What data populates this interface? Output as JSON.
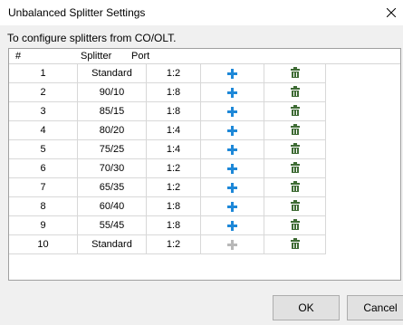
{
  "window": {
    "title": "Unbalanced Splitter Settings",
    "close_icon": "close-icon"
  },
  "instructions": "To configure splitters from CO/OLT.",
  "table": {
    "headers": [
      "#",
      "Splitter",
      "Port"
    ],
    "rows": [
      {
        "num": "1",
        "splitter": "Standard",
        "port": "1:2",
        "add_enabled": true
      },
      {
        "num": "2",
        "splitter": "90/10",
        "port": "1:8",
        "add_enabled": true
      },
      {
        "num": "3",
        "splitter": "85/15",
        "port": "1:8",
        "add_enabled": true
      },
      {
        "num": "4",
        "splitter": "80/20",
        "port": "1:4",
        "add_enabled": true
      },
      {
        "num": "5",
        "splitter": "75/25",
        "port": "1:4",
        "add_enabled": true
      },
      {
        "num": "6",
        "splitter": "70/30",
        "port": "1:2",
        "add_enabled": true
      },
      {
        "num": "7",
        "splitter": "65/35",
        "port": "1:2",
        "add_enabled": true
      },
      {
        "num": "8",
        "splitter": "60/40",
        "port": "1:8",
        "add_enabled": true
      },
      {
        "num": "9",
        "splitter": "55/45",
        "port": "1:8",
        "add_enabled": true
      },
      {
        "num": "10",
        "splitter": "Standard",
        "port": "1:2",
        "add_enabled": false
      }
    ],
    "icons": {
      "add": "plus-icon",
      "delete": "trash-icon"
    }
  },
  "buttons": {
    "ok": "OK",
    "cancel": "Cancel"
  },
  "colors": {
    "add_enabled": "#1e88d8",
    "add_disabled": "#b8b8b8",
    "delete": "#3e6b34"
  }
}
